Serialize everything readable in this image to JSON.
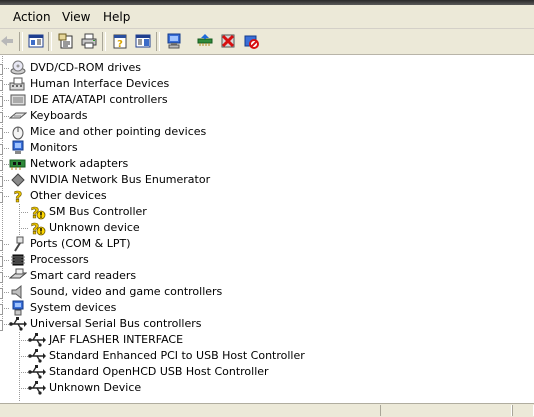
{
  "menubar": {
    "items": [
      {
        "label": "Action"
      },
      {
        "label": "View"
      },
      {
        "label": "Help"
      }
    ]
  },
  "toolbar": {
    "buttons": [
      {
        "icon": "back-icon"
      },
      {
        "icon": "console-tree-icon"
      },
      {
        "icon": "properties-icon"
      },
      {
        "icon": "print-icon"
      },
      {
        "icon": "help-icon"
      },
      {
        "icon": "show-hide-icon"
      },
      {
        "icon": "scan-hardware-icon"
      },
      {
        "icon": "update-driver-icon"
      },
      {
        "icon": "uninstall-icon"
      },
      {
        "icon": "disable-icon"
      }
    ]
  },
  "tree": {
    "nodes": [
      {
        "label": "DVD/CD-ROM drives",
        "icon": "dvd-drive-icon",
        "level": 0
      },
      {
        "label": "Human Interface Devices",
        "icon": "hid-icon",
        "level": 0
      },
      {
        "label": "IDE ATA/ATAPI controllers",
        "icon": "ide-controller-icon",
        "level": 0
      },
      {
        "label": "Keyboards",
        "icon": "keyboard-icon",
        "level": 0
      },
      {
        "label": "Mice and other pointing devices",
        "icon": "mouse-icon",
        "level": 0
      },
      {
        "label": "Monitors",
        "icon": "monitor-icon",
        "level": 0
      },
      {
        "label": "Network adapters",
        "icon": "network-adapter-icon",
        "level": 0
      },
      {
        "label": "NVIDIA Network Bus Enumerator",
        "icon": "bus-enumerator-icon",
        "level": 0
      },
      {
        "label": "Other devices",
        "icon": "unknown-device-icon",
        "level": 0
      },
      {
        "label": "SM Bus Controller",
        "icon": "warning-device-icon",
        "level": 1
      },
      {
        "label": "Unknown device",
        "icon": "warning-device-icon",
        "level": 1
      },
      {
        "label": "Ports (COM & LPT)",
        "icon": "port-icon",
        "level": 0
      },
      {
        "label": "Processors",
        "icon": "processor-icon",
        "level": 0
      },
      {
        "label": "Smart card readers",
        "icon": "smart-card-icon",
        "level": 0
      },
      {
        "label": "Sound, video and game controllers",
        "icon": "sound-icon",
        "level": 0
      },
      {
        "label": "System devices",
        "icon": "system-device-icon",
        "level": 0
      },
      {
        "label": "Universal Serial Bus controllers",
        "icon": "usb-icon",
        "level": 0
      },
      {
        "label": "JAF FLASHER INTERFACE",
        "icon": "usb-icon",
        "level": 1
      },
      {
        "label": "Standard Enhanced PCI to USB Host Controller",
        "icon": "usb-icon",
        "level": 1
      },
      {
        "label": "Standard OpenHCD USB Host Controller",
        "icon": "usb-icon",
        "level": 1
      },
      {
        "label": "Unknown Device",
        "icon": "usb-icon",
        "level": 1
      }
    ]
  }
}
